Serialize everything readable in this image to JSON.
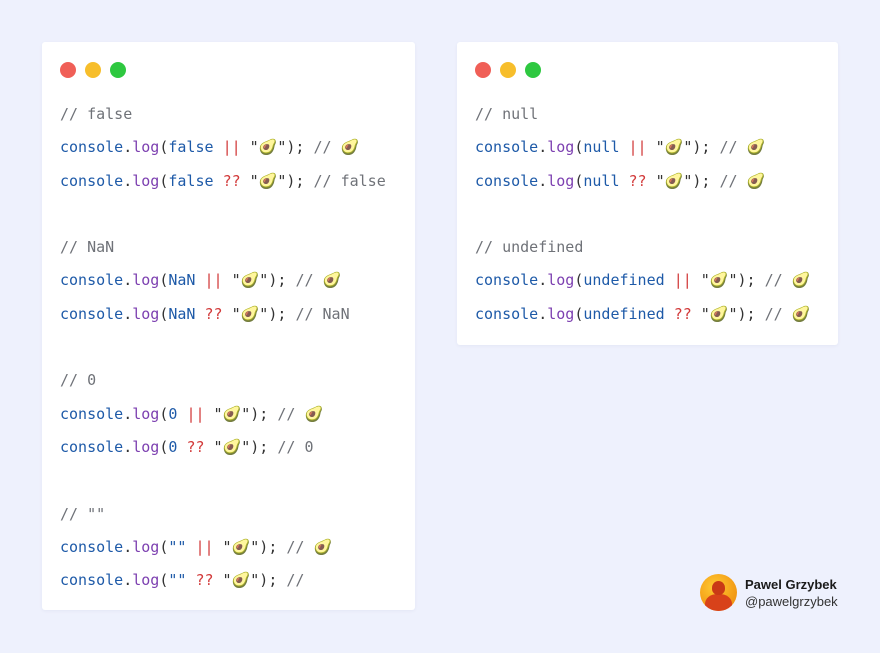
{
  "left_card": {
    "lines": [
      [
        {
          "t": "// false",
          "c": "comment"
        }
      ],
      [
        {
          "t": "console",
          "c": "console"
        },
        {
          "t": ".",
          "c": "dot"
        },
        {
          "t": "log",
          "c": "log"
        },
        {
          "t": "(",
          "c": "paren"
        },
        {
          "t": "false",
          "c": "kw"
        },
        {
          "t": " ",
          "c": "punct"
        },
        {
          "t": "||",
          "c": "op"
        },
        {
          "t": " \"🥑\"); ",
          "c": "str"
        },
        {
          "t": "// 🥑",
          "c": "comment"
        }
      ],
      [
        {
          "t": "console",
          "c": "console"
        },
        {
          "t": ".",
          "c": "dot"
        },
        {
          "t": "log",
          "c": "log"
        },
        {
          "t": "(",
          "c": "paren"
        },
        {
          "t": "false",
          "c": "kw"
        },
        {
          "t": " ",
          "c": "punct"
        },
        {
          "t": "??",
          "c": "op"
        },
        {
          "t": " \"🥑\"); ",
          "c": "str"
        },
        {
          "t": "// false",
          "c": "comment"
        }
      ],
      [],
      [
        {
          "t": "// NaN",
          "c": "comment"
        }
      ],
      [
        {
          "t": "console",
          "c": "console"
        },
        {
          "t": ".",
          "c": "dot"
        },
        {
          "t": "log",
          "c": "log"
        },
        {
          "t": "(",
          "c": "paren"
        },
        {
          "t": "NaN",
          "c": "kw"
        },
        {
          "t": " ",
          "c": "punct"
        },
        {
          "t": "||",
          "c": "op"
        },
        {
          "t": " \"🥑\"); ",
          "c": "str"
        },
        {
          "t": "// 🥑",
          "c": "comment"
        }
      ],
      [
        {
          "t": "console",
          "c": "console"
        },
        {
          "t": ".",
          "c": "dot"
        },
        {
          "t": "log",
          "c": "log"
        },
        {
          "t": "(",
          "c": "paren"
        },
        {
          "t": "NaN",
          "c": "kw"
        },
        {
          "t": " ",
          "c": "punct"
        },
        {
          "t": "??",
          "c": "op"
        },
        {
          "t": " \"🥑\"); ",
          "c": "str"
        },
        {
          "t": "// NaN",
          "c": "comment"
        }
      ],
      [],
      [
        {
          "t": "// 0",
          "c": "comment"
        }
      ],
      [
        {
          "t": "console",
          "c": "console"
        },
        {
          "t": ".",
          "c": "dot"
        },
        {
          "t": "log",
          "c": "log"
        },
        {
          "t": "(",
          "c": "paren"
        },
        {
          "t": "0",
          "c": "kw"
        },
        {
          "t": " ",
          "c": "punct"
        },
        {
          "t": "||",
          "c": "op"
        },
        {
          "t": " \"🥑\"); ",
          "c": "str"
        },
        {
          "t": "// 🥑",
          "c": "comment"
        }
      ],
      [
        {
          "t": "console",
          "c": "console"
        },
        {
          "t": ".",
          "c": "dot"
        },
        {
          "t": "log",
          "c": "log"
        },
        {
          "t": "(",
          "c": "paren"
        },
        {
          "t": "0",
          "c": "kw"
        },
        {
          "t": " ",
          "c": "punct"
        },
        {
          "t": "??",
          "c": "op"
        },
        {
          "t": " \"🥑\"); ",
          "c": "str"
        },
        {
          "t": "// 0",
          "c": "comment"
        }
      ],
      [],
      [
        {
          "t": "// \"\"",
          "c": "comment"
        }
      ],
      [
        {
          "t": "console",
          "c": "console"
        },
        {
          "t": ".",
          "c": "dot"
        },
        {
          "t": "log",
          "c": "log"
        },
        {
          "t": "(",
          "c": "paren"
        },
        {
          "t": "\"\"",
          "c": "kw"
        },
        {
          "t": " ",
          "c": "punct"
        },
        {
          "t": "||",
          "c": "op"
        },
        {
          "t": " \"🥑\"); ",
          "c": "str"
        },
        {
          "t": "// 🥑",
          "c": "comment"
        }
      ],
      [
        {
          "t": "console",
          "c": "console"
        },
        {
          "t": ".",
          "c": "dot"
        },
        {
          "t": "log",
          "c": "log"
        },
        {
          "t": "(",
          "c": "paren"
        },
        {
          "t": "\"\"",
          "c": "kw"
        },
        {
          "t": " ",
          "c": "punct"
        },
        {
          "t": "??",
          "c": "op"
        },
        {
          "t": " \"🥑\"); ",
          "c": "str"
        },
        {
          "t": "//",
          "c": "comment"
        }
      ]
    ]
  },
  "right_card": {
    "lines": [
      [
        {
          "t": "// null",
          "c": "comment"
        }
      ],
      [
        {
          "t": "console",
          "c": "console"
        },
        {
          "t": ".",
          "c": "dot"
        },
        {
          "t": "log",
          "c": "log"
        },
        {
          "t": "(",
          "c": "paren"
        },
        {
          "t": "null",
          "c": "kw"
        },
        {
          "t": " ",
          "c": "punct"
        },
        {
          "t": "||",
          "c": "op"
        },
        {
          "t": " \"🥑\"); ",
          "c": "str"
        },
        {
          "t": "// 🥑",
          "c": "comment"
        }
      ],
      [
        {
          "t": "console",
          "c": "console"
        },
        {
          "t": ".",
          "c": "dot"
        },
        {
          "t": "log",
          "c": "log"
        },
        {
          "t": "(",
          "c": "paren"
        },
        {
          "t": "null",
          "c": "kw"
        },
        {
          "t": " ",
          "c": "punct"
        },
        {
          "t": "??",
          "c": "op"
        },
        {
          "t": " \"🥑\"); ",
          "c": "str"
        },
        {
          "t": "// 🥑",
          "c": "comment"
        }
      ],
      [],
      [
        {
          "t": "// undefined",
          "c": "comment"
        }
      ],
      [
        {
          "t": "console",
          "c": "console"
        },
        {
          "t": ".",
          "c": "dot"
        },
        {
          "t": "log",
          "c": "log"
        },
        {
          "t": "(",
          "c": "paren"
        },
        {
          "t": "undefined",
          "c": "kw"
        },
        {
          "t": " ",
          "c": "punct"
        },
        {
          "t": "||",
          "c": "op"
        },
        {
          "t": " \"🥑\"); ",
          "c": "str"
        },
        {
          "t": "// 🥑",
          "c": "comment"
        }
      ],
      [
        {
          "t": "console",
          "c": "console"
        },
        {
          "t": ".",
          "c": "dot"
        },
        {
          "t": "log",
          "c": "log"
        },
        {
          "t": "(",
          "c": "paren"
        },
        {
          "t": "undefined",
          "c": "kw"
        },
        {
          "t": " ",
          "c": "punct"
        },
        {
          "t": "??",
          "c": "op"
        },
        {
          "t": " \"🥑\"); ",
          "c": "str"
        },
        {
          "t": "// 🥑",
          "c": "comment"
        }
      ]
    ]
  },
  "window_dots": {
    "red": "#f05f57",
    "yellow": "#f7be2b",
    "green": "#2ec840"
  },
  "author": {
    "name": "Pawel Grzybek",
    "handle": "@pawelgrzybek",
    "avatar_icon": "person-avatar-icon"
  },
  "colors": {
    "background": "#eef1fd",
    "card": "#ffffff",
    "comment": "#6f7278",
    "identifier": "#1e5aa8",
    "method": "#7c3fb0",
    "operator": "#d23a3a"
  }
}
